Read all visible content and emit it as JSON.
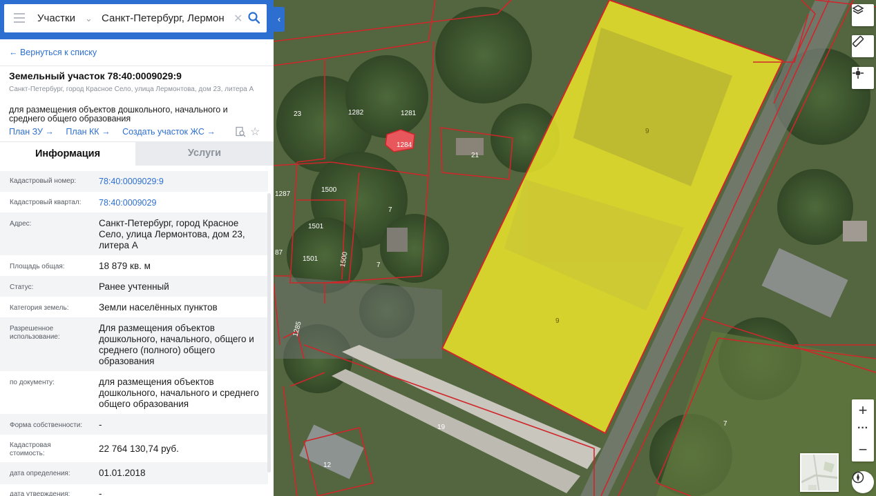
{
  "search": {
    "type_label": "Участки",
    "query": "Санкт-Петербург, Лермон"
  },
  "back_link": "← Вернуться к списку",
  "parcel": {
    "title": "Земельный участок 78:40:0009029:9",
    "address": "Санкт-Петербург, город Красное Село, улица Лермонтова, дом 23, литера А",
    "purpose": "для размещения объектов дошкольного, начального и среднего общего образования"
  },
  "links": {
    "plan_zu": "План ЗУ →",
    "plan_kk": "План КК →",
    "create": "Создать участок ЖС →"
  },
  "tabs": {
    "info": "Информация",
    "services": "Услуги"
  },
  "info": {
    "cad_number_label": "Кадастровый номер:",
    "cad_number": "78:40:0009029:9",
    "cad_quarter_label": "Кадастровый квартал:",
    "cad_quarter": "78:40:0009029",
    "address_label": "Адрес:",
    "address": "Санкт-Петербург, город Красное Село, улица Лермонтова, дом 23, литера А",
    "area_label": "Площадь общая:",
    "area": "18 879 кв. м",
    "status_label": "Статус:",
    "status": "Ранее учтенный",
    "category_label": "Категория земель:",
    "category": "Земли населённых пунктов",
    "permitted_label": "Разрешенное использование:",
    "permitted": "Для размещения объектов дошкольного, начального, общего и среднего (полного) общего образования",
    "by_doc_label": "по документу:",
    "by_doc": "для размещения объектов дошкольного, начального и среднего общего образования",
    "ownership_label": "Форма собственности:",
    "ownership": "-",
    "cad_value_label": "Кадастровая стоимость:",
    "cad_value": "22 764 130,74 руб.",
    "det_date_label": "дата определения:",
    "det_date": "01.01.2018",
    "appr_date_label": "дата утверждения:",
    "appr_date": "-"
  },
  "map_labels": {
    "p23": "23",
    "p1282": "1282",
    "p1281": "1281",
    "p1284": "1284",
    "p21": "21",
    "p9a": "9",
    "p9b": "9",
    "p1287": "1287",
    "p1500a": "1500",
    "p7a": "7",
    "p1501a": "1501",
    "p1501b": "1501",
    "p1500b": "1500",
    "p7b": "7",
    "p87": "87",
    "p1285": "1285",
    "p19": "19",
    "p12": "12",
    "p7c": "7"
  },
  "colors": {
    "accent": "#2d6fd1",
    "highlight_parcel": "#f2ea2a",
    "parcel_border": "#d0262b",
    "selected_small_parcel": "#e8575c"
  },
  "icons": {
    "layers": "layers-icon",
    "ruler": "ruler-icon",
    "locate": "crosshair-icon",
    "zoom_in": "plus-icon",
    "more": "more-icon",
    "zoom_out": "minus-icon",
    "compass": "compass-icon"
  }
}
